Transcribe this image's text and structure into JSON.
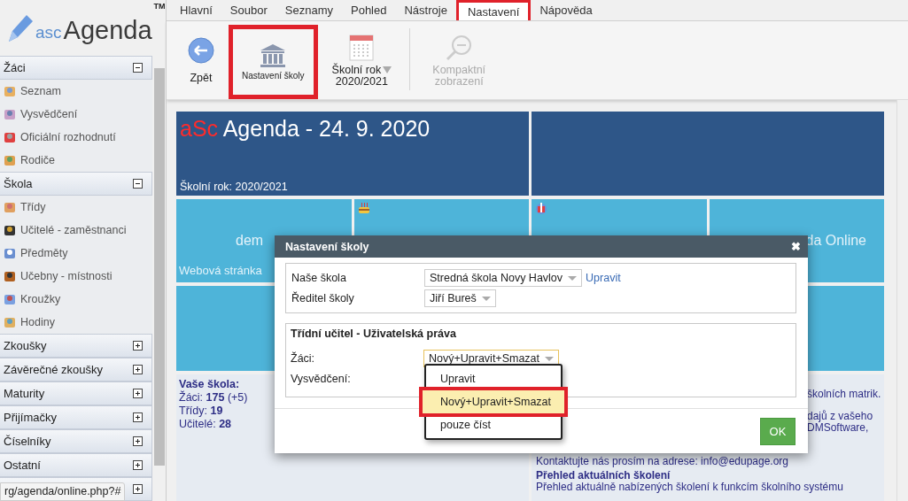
{
  "logo": {
    "prefix": "asc",
    "name": "Agenda",
    "mark": "TM"
  },
  "sidebar": {
    "sections": [
      {
        "label": "Žáci",
        "expanded": true,
        "items": [
          {
            "label": "Seznam"
          },
          {
            "label": "Vysvědčení"
          },
          {
            "label": "Oficiální rozhodnutí"
          },
          {
            "label": "Rodiče"
          }
        ]
      },
      {
        "label": "Škola",
        "expanded": true,
        "items": [
          {
            "label": "Třídy"
          },
          {
            "label": "Učitelé - zaměstnanci"
          },
          {
            "label": "Předměty"
          },
          {
            "label": "Učebny - místnosti"
          },
          {
            "label": "Kroužky"
          },
          {
            "label": "Hodiny"
          }
        ]
      },
      {
        "label": "Zkoušky",
        "expanded": false
      },
      {
        "label": "Závěrečné zkoušky",
        "expanded": false
      },
      {
        "label": "Maturity",
        "expanded": false
      },
      {
        "label": "Přijímačky",
        "expanded": false
      },
      {
        "label": "Číselníky",
        "expanded": false
      },
      {
        "label": "Ostatní",
        "expanded": false
      },
      {
        "expanded": false
      }
    ]
  },
  "menu": [
    {
      "label": "Hlavní",
      "selected": false
    },
    {
      "label": "Soubor",
      "selected": false
    },
    {
      "label": "Seznamy",
      "selected": false
    },
    {
      "label": "Pohled",
      "selected": false
    },
    {
      "label": "Nástroje",
      "selected": false
    },
    {
      "label": "Nastavení",
      "selected": true
    },
    {
      "label": "Nápověda",
      "selected": false
    }
  ],
  "toolbar": [
    {
      "kind": "back",
      "label": "Zpět",
      "highlighted": false,
      "disabled": false
    },
    {
      "kind": "school",
      "label": "Nastavení školy",
      "highlighted": true,
      "disabled": false
    },
    {
      "kind": "year",
      "label": "Školní rok",
      "value": "2020/2021",
      "highlighted": false,
      "disabled": false
    },
    {
      "kind": "zoom",
      "label": "Kompaktní zobrazení",
      "highlighted": false,
      "disabled": true
    }
  ],
  "header_tile": {
    "brand": "aSc",
    "title": "Agenda - 24. 9. 2020",
    "year": "Školní rok: 2020/2021"
  },
  "tiles": [
    {
      "kind": "web",
      "title": "dem",
      "link": "Webová stránka"
    },
    {
      "kind": "cake"
    },
    {
      "kind": "gift"
    },
    {
      "kind": "online",
      "title": "da Online"
    }
  ],
  "school_info": {
    "title": "Vaše škola:",
    "lines": [
      {
        "label": "Žáci:",
        "value": "175",
        "extra": "(+5)"
      },
      {
        "label": "Třídy:",
        "value": "19"
      },
      {
        "label": "Učitelé:",
        "value": "28"
      }
    ]
  },
  "news": [
    {
      "kind": "tail",
      "text": "školních matrik."
    },
    {
      "kind": "tail",
      "text": "dajů z vašeho"
    },
    {
      "kind": "tail",
      "text": "DMSoftware,"
    },
    {
      "kind": "text",
      "text": "Kontaktujte nás prosím na adrese: info@edupage.org"
    },
    {
      "kind": "heading",
      "text": "Přehled aktuálních školení"
    },
    {
      "kind": "text",
      "text": "Přehled aktuálně nabízených školení k funkcím školního systému"
    }
  ],
  "dialog": {
    "title": "Nastavení školy",
    "close": "✖",
    "school_fields": [
      {
        "label": "Naše škola",
        "value": "Stredná škola Novy Havlov",
        "link": "Upravit"
      },
      {
        "label": "Ředitel školy",
        "value": "Jiří Bureš"
      }
    ],
    "rights": {
      "title": "Třídní učitel - Uživatelská práva",
      "fields": [
        {
          "label": "Žáci:",
          "value": "Nový+Upravit+Smazat",
          "open": true
        },
        {
          "label": "Vysvědčení:"
        }
      ]
    },
    "options": [
      {
        "label": "Upravit",
        "selected": false,
        "highlighted": false
      },
      {
        "label": "Nový+Upravit+Smazat",
        "selected": true,
        "highlighted": true
      },
      {
        "label": "pouze číst",
        "selected": false,
        "highlighted": false
      }
    ],
    "ok": "OK"
  },
  "status_url": "rg/agenda/online.php?#"
}
